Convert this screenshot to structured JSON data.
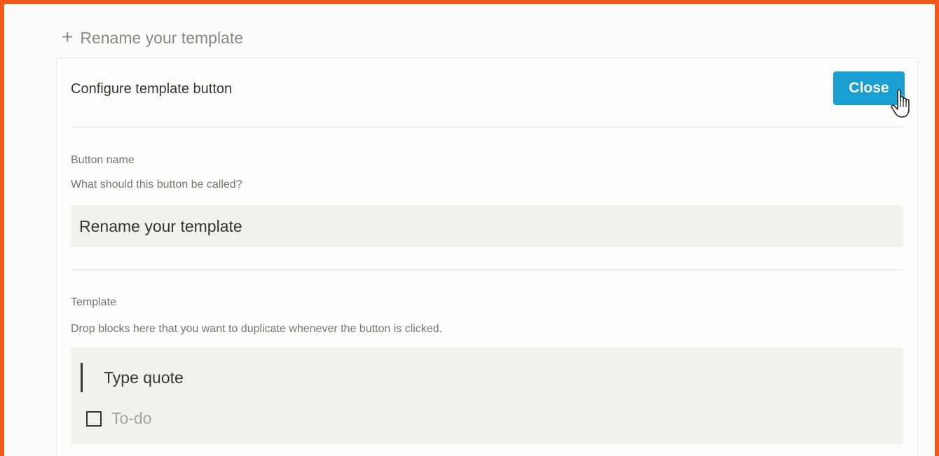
{
  "template_button": {
    "icon": "plus-icon",
    "label": "Rename your template"
  },
  "config_panel": {
    "title": "Configure template button",
    "close_label": "Close"
  },
  "button_name": {
    "label": "Button name",
    "hint": "What should this button be called?",
    "value": "Rename your template"
  },
  "template_section": {
    "label": "Template",
    "hint": "Drop blocks here that you want to duplicate whenever the button is clicked.",
    "quote_text": "Type quote",
    "todo_placeholder": "To-do"
  },
  "colors": {
    "frame_border": "#f0581e",
    "close_button": "#1a9fd2"
  }
}
